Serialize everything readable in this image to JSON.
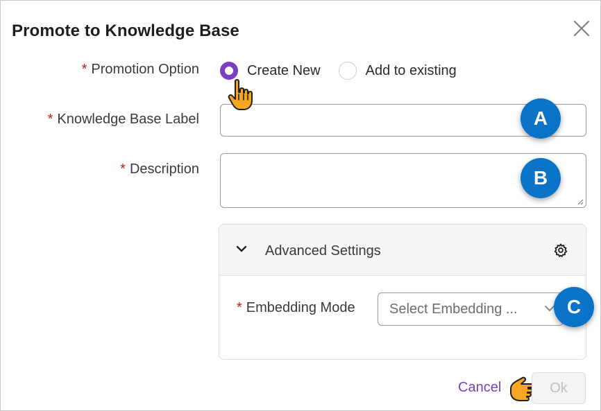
{
  "dialog": {
    "title": "Promote to Knowledge Base"
  },
  "form": {
    "required_marker": "*",
    "promotion_option": {
      "label": "Promotion Option",
      "options": [
        {
          "label": "Create New",
          "selected": true
        },
        {
          "label": "Add to existing",
          "selected": false
        }
      ]
    },
    "kb_label": {
      "label": "Knowledge Base Label",
      "value": "",
      "placeholder": ""
    },
    "description": {
      "label": "Description",
      "value": "",
      "placeholder": ""
    }
  },
  "advanced_settings": {
    "title": "Advanced Settings",
    "expanded": true,
    "embedding_mode": {
      "label": "Embedding Mode",
      "placeholder": "Select Embedding ..."
    }
  },
  "callouts": {
    "a": "A",
    "b": "B",
    "c": "C"
  },
  "footer": {
    "cancel_label": "Cancel",
    "ok_label": "Ok",
    "ok_disabled": true
  },
  "icons": {
    "close": "close-icon",
    "chevron_down": "chevron-down-icon",
    "gear": "gear-icon",
    "pointer_hand": "pointer-hand-icon"
  },
  "colors": {
    "accent": "#7b3fc4",
    "required": "#b42318",
    "callout": "#0b74c8",
    "hand": "#f5a623"
  }
}
